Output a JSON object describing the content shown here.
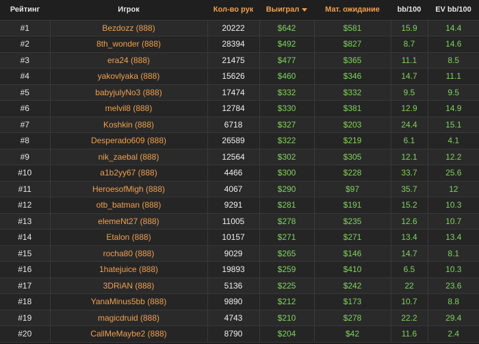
{
  "headers": {
    "rank": "Рейтинг",
    "player": "Игрок",
    "hands": "Кол-во рук",
    "won": "Выиграл",
    "ev": "Мат. ожидание",
    "bb100": "bb/100",
    "evbb100": "EV bb/100"
  },
  "colors": {
    "background": "#1f1f1f",
    "accent_orange": "#f0a050",
    "money_green": "#7fd45e"
  },
  "sort": {
    "column": "won",
    "direction": "desc",
    "icon": "triangle-down-icon"
  },
  "rows": [
    {
      "rank": "#1",
      "player": "Bezdozz (888)",
      "hands": "20222",
      "won": "$642",
      "ev": "$581",
      "bb100": "15.9",
      "evbb100": "14.4"
    },
    {
      "rank": "#2",
      "player": "8th_wonder (888)",
      "hands": "28394",
      "won": "$492",
      "ev": "$827",
      "bb100": "8.7",
      "evbb100": "14.6"
    },
    {
      "rank": "#3",
      "player": "era24 (888)",
      "hands": "21475",
      "won": "$477",
      "ev": "$365",
      "bb100": "11.1",
      "evbb100": "8.5"
    },
    {
      "rank": "#4",
      "player": "yakovlyaka (888)",
      "hands": "15626",
      "won": "$460",
      "ev": "$346",
      "bb100": "14.7",
      "evbb100": "11.1"
    },
    {
      "rank": "#5",
      "player": "babyjulyNo3 (888)",
      "hands": "17474",
      "won": "$332",
      "ev": "$332",
      "bb100": "9.5",
      "evbb100": "9.5"
    },
    {
      "rank": "#6",
      "player": "melvil8 (888)",
      "hands": "12784",
      "won": "$330",
      "ev": "$381",
      "bb100": "12.9",
      "evbb100": "14.9"
    },
    {
      "rank": "#7",
      "player": "Koshkin (888)",
      "hands": "6718",
      "won": "$327",
      "ev": "$203",
      "bb100": "24.4",
      "evbb100": "15.1"
    },
    {
      "rank": "#8",
      "player": "Desperado609 (888)",
      "hands": "26589",
      "won": "$322",
      "ev": "$219",
      "bb100": "6.1",
      "evbb100": "4.1"
    },
    {
      "rank": "#9",
      "player": "nik_zaebal (888)",
      "hands": "12564",
      "won": "$302",
      "ev": "$305",
      "bb100": "12.1",
      "evbb100": "12.2"
    },
    {
      "rank": "#10",
      "player": "a1b2yy67 (888)",
      "hands": "4466",
      "won": "$300",
      "ev": "$228",
      "bb100": "33.7",
      "evbb100": "25.6"
    },
    {
      "rank": "#11",
      "player": "HeroesofMigh (888)",
      "hands": "4067",
      "won": "$290",
      "ev": "$97",
      "bb100": "35.7",
      "evbb100": "12"
    },
    {
      "rank": "#12",
      "player": "otb_batman (888)",
      "hands": "9291",
      "won": "$281",
      "ev": "$191",
      "bb100": "15.2",
      "evbb100": "10.3"
    },
    {
      "rank": "#13",
      "player": "elemeNt27 (888)",
      "hands": "11005",
      "won": "$278",
      "ev": "$235",
      "bb100": "12.6",
      "evbb100": "10.7"
    },
    {
      "rank": "#14",
      "player": "Etalon (888)",
      "hands": "10157",
      "won": "$271",
      "ev": "$271",
      "bb100": "13.4",
      "evbb100": "13.4"
    },
    {
      "rank": "#15",
      "player": "rocha80 (888)",
      "hands": "9029",
      "won": "$265",
      "ev": "$146",
      "bb100": "14.7",
      "evbb100": "8.1"
    },
    {
      "rank": "#16",
      "player": "1hatejuice (888)",
      "hands": "19893",
      "won": "$259",
      "ev": "$410",
      "bb100": "6.5",
      "evbb100": "10.3"
    },
    {
      "rank": "#17",
      "player": "3DRiAN (888)",
      "hands": "5136",
      "won": "$225",
      "ev": "$242",
      "bb100": "22",
      "evbb100": "23.6"
    },
    {
      "rank": "#18",
      "player": "YanaMinus5bb (888)",
      "hands": "9890",
      "won": "$212",
      "ev": "$173",
      "bb100": "10.7",
      "evbb100": "8.8"
    },
    {
      "rank": "#19",
      "player": "magicdruid (888)",
      "hands": "4743",
      "won": "$210",
      "ev": "$278",
      "bb100": "22.2",
      "evbb100": "29.4"
    },
    {
      "rank": "#20",
      "player": "CallMeMaybe2 (888)",
      "hands": "8790",
      "won": "$204",
      "ev": "$42",
      "bb100": "11.6",
      "evbb100": "2.4"
    }
  ]
}
